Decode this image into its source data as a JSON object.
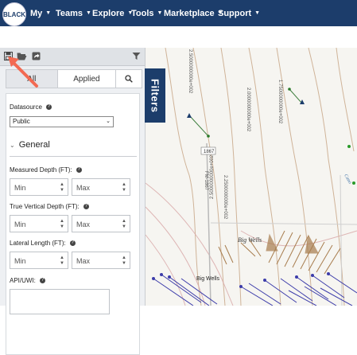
{
  "nav": {
    "logo_text": "BLACK",
    "menu": [
      {
        "label": "My"
      },
      {
        "label": "Teams"
      },
      {
        "label": "Explore"
      },
      {
        "label": "Tools"
      },
      {
        "label": "Marketplace"
      },
      {
        "label": "Support"
      }
    ]
  },
  "toolbar": {
    "icons": [
      "save-icon",
      "folder-open-icon",
      "share-icon",
      "filter-icon"
    ]
  },
  "tabs": [
    {
      "label": "All",
      "active": true
    },
    {
      "label": "Applied",
      "active": false
    },
    {
      "label": "",
      "icon": "search-icon"
    }
  ],
  "filters": {
    "datasource_label": "Datasource",
    "datasource_value": "Public",
    "section_title": "General",
    "measured_depth_label": "Measured Depth (FT):",
    "tvd_label": "True Vertical Depth (FT):",
    "lateral_length_label": "Lateral Length (FT):",
    "api_label": "API/UWI:",
    "min_placeholder": "Min",
    "max_placeholder": "Max"
  },
  "filters_tab_label": "Filters",
  "map": {
    "labels": [
      "2.5000000000e+002",
      "2.0000000000e+002",
      "1.7500000000e+002",
      "2.5000000000e+002",
      "2.2500000000e+002",
      "FM-1867",
      "1867",
      "Big Wells",
      "Big Wells",
      "Cano"
    ]
  },
  "colors": {
    "navbar": "#1c3d6b",
    "arrow": "#f26a52",
    "panel": "#eef0f3",
    "contour_brown": "#c9a889",
    "contour_pink": "#d8a6a6",
    "well_blue": "#3c3caa",
    "well_tan": "#a77c4d"
  }
}
